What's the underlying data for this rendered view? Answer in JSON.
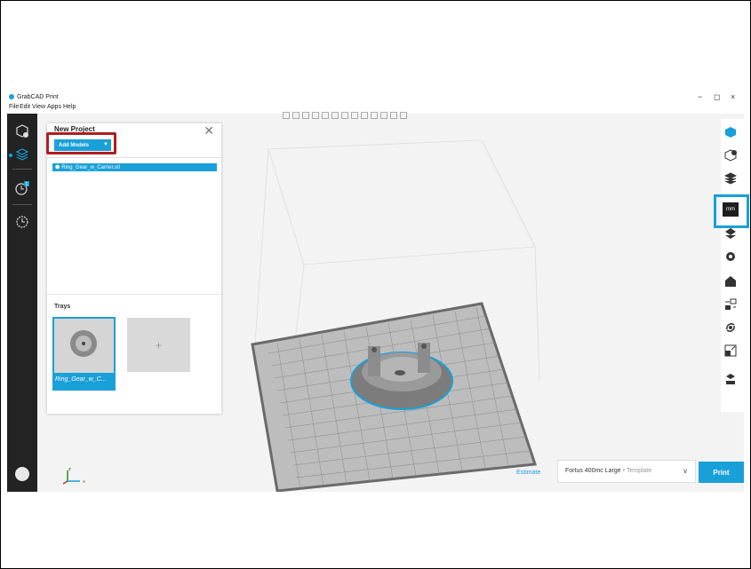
{
  "app": {
    "title": "GrabCAD Print",
    "menu": [
      "File",
      "Edit",
      "View",
      "Apps",
      "Help"
    ],
    "window_controls": [
      "−",
      "◻",
      "×"
    ]
  },
  "sidebar": {
    "items": [
      {
        "icon": "add-model-icon"
      },
      {
        "icon": "print-prep-icon",
        "active": true
      },
      {
        "icon": "queue-clock-icon",
        "badge": "1"
      },
      {
        "icon": "history-icon"
      }
    ]
  },
  "panel": {
    "title": "New Project",
    "add_models_label": "Add Models",
    "file_name": "Ring_Gear_w_Carrier.stl",
    "trays_label": "Trays",
    "tray_name": "Ring_Gear_w_C...",
    "add_tray_label": "+"
  },
  "toolbar": {
    "icon_count": 14
  },
  "right_tools": [
    "cube-icon",
    "cube-check-icon",
    "layers-icon",
    "units-mm-icon",
    "model-settings-icon",
    "gear-icon",
    "support-icon",
    "move-icon",
    "rotate-icon",
    "scale-icon",
    "report-icon"
  ],
  "units": {
    "label": "mm"
  },
  "bottom": {
    "estimate_label": "Estimate",
    "printer_name": "Fortus 400mc Large",
    "printer_sub": " • Template",
    "print_label": "Print"
  },
  "axes": {
    "x": "x",
    "z": "z"
  },
  "colors": {
    "accent": "#1aa0d8",
    "highlight_red": "#b01e1e",
    "sidebar": "#232323"
  }
}
